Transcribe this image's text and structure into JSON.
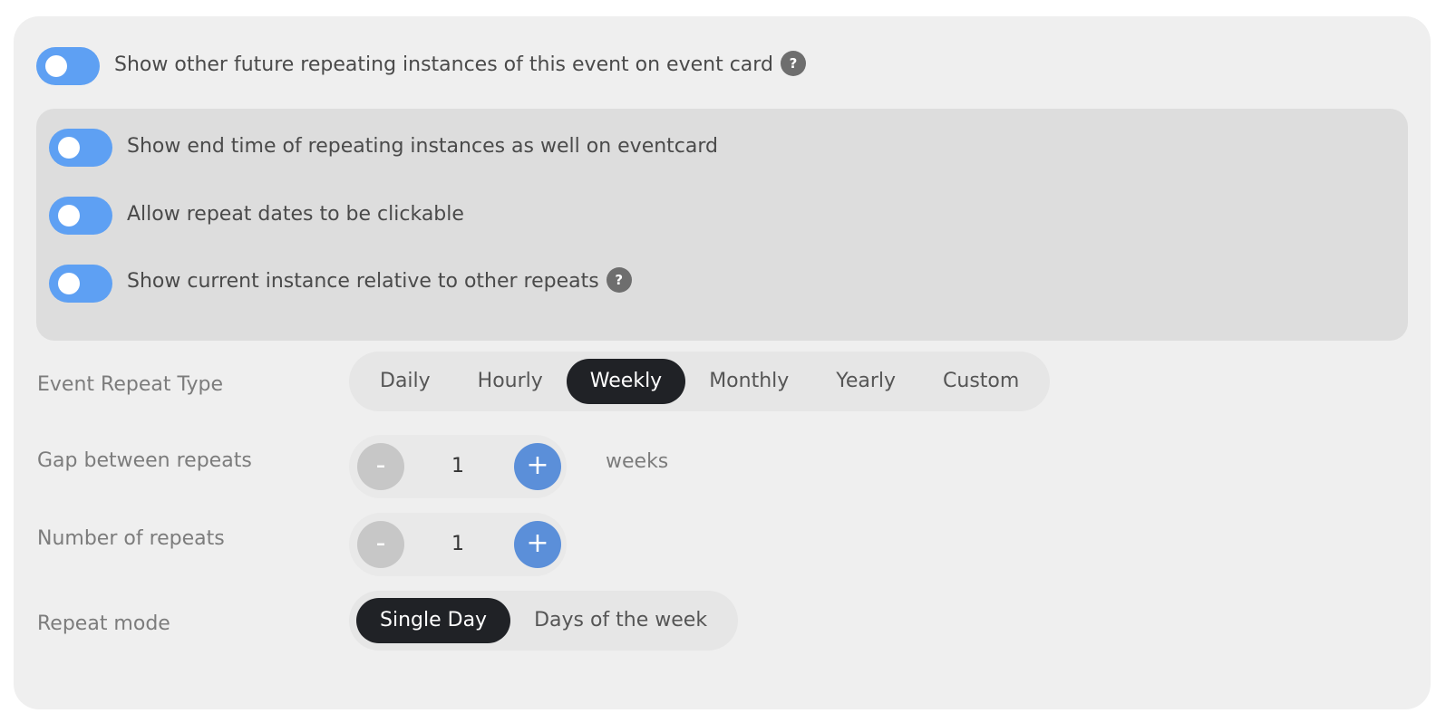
{
  "toggles": {
    "show_future_instances": {
      "label": "Show other future repeating instances of this event on event card",
      "on": true
    },
    "show_end_time": {
      "label": "Show end time of repeating instances as well on eventcard",
      "on": true
    },
    "clickable_dates": {
      "label": "Allow repeat dates to be clickable",
      "on": true
    },
    "show_current_instance": {
      "label": "Show current instance relative to other repeats",
      "on": true
    }
  },
  "help_glyph": "?",
  "repeat_type": {
    "label": "Event Repeat Type",
    "options": [
      "Daily",
      "Hourly",
      "Weekly",
      "Monthly",
      "Yearly",
      "Custom"
    ],
    "selected": "Weekly"
  },
  "gap": {
    "label": "Gap between repeats",
    "value": "1",
    "unit": "weeks",
    "minus": "-",
    "plus": "+"
  },
  "count": {
    "label": "Number of repeats",
    "value": "1",
    "minus": "-",
    "plus": "+"
  },
  "repeat_mode": {
    "label": "Repeat mode",
    "options": [
      "Single Day",
      "Days of the week"
    ],
    "selected": "Single Day"
  },
  "colors": {
    "toggle_on": "#5ea0f3",
    "active_segment": "#202226",
    "plus_button": "#5b8fd9",
    "minus_button": "#c7c7c7"
  }
}
